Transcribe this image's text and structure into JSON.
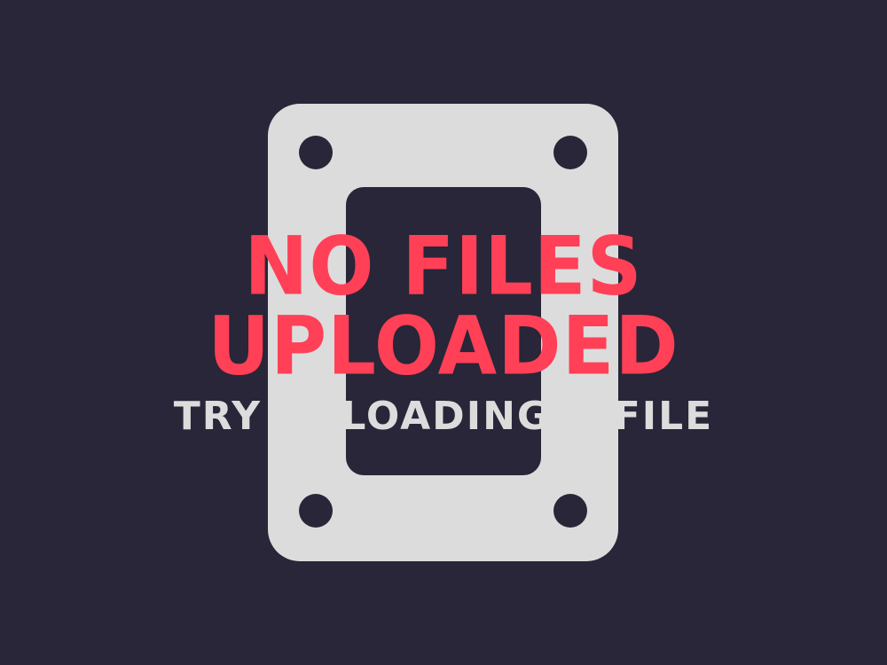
{
  "empty_state": {
    "headline_line_1": "NO FILES",
    "headline_line_2": "UPLOADED",
    "subtitle": "TRY UPLOADING A FILE",
    "icon": "hard-drive-bracket-icon"
  },
  "colors": {
    "background": "#282638",
    "plate": "#dcdcdc",
    "headline": "#ff4057",
    "subtitle": "#dcdcdc"
  }
}
